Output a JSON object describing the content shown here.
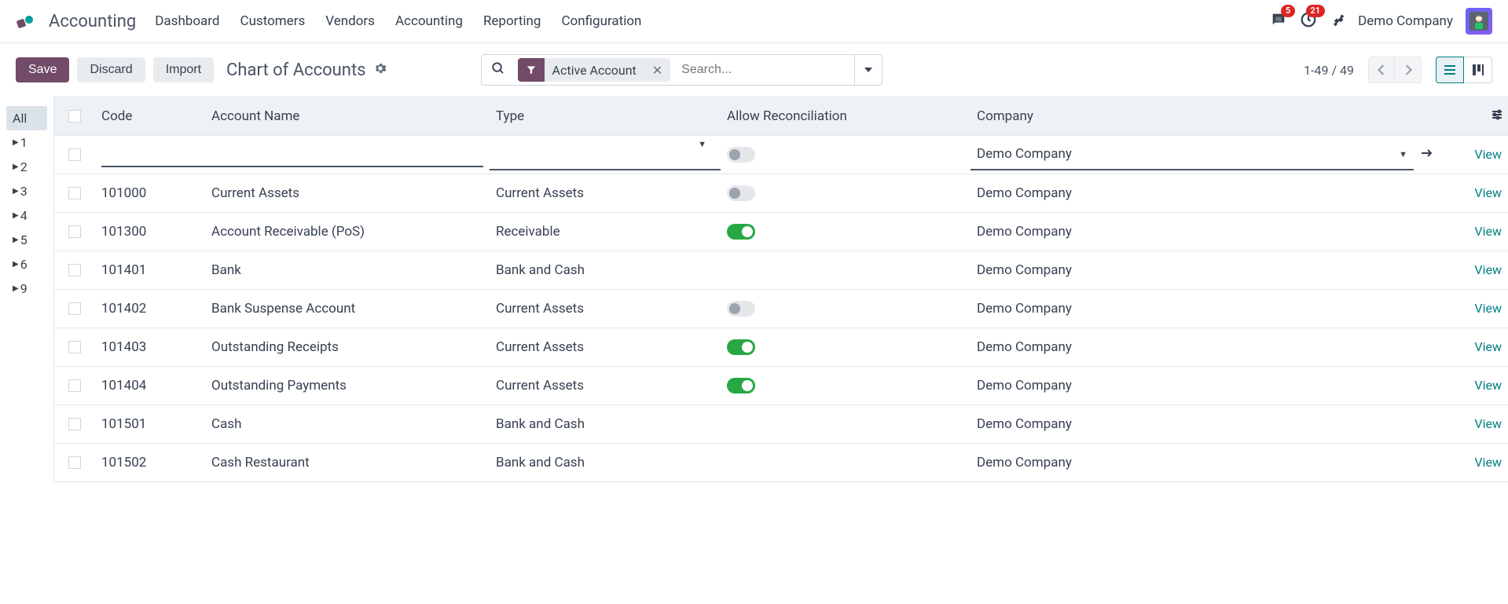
{
  "app_name": "Accounting",
  "nav": [
    "Dashboard",
    "Customers",
    "Vendors",
    "Accounting",
    "Reporting",
    "Configuration"
  ],
  "msg_badge": "5",
  "activity_badge": "21",
  "company": "Demo Company",
  "buttons": {
    "save": "Save",
    "discard": "Discard",
    "import": "Import"
  },
  "page_title": "Chart of Accounts",
  "filter_chip": "Active Account",
  "search_placeholder": "Search...",
  "pager": "1-49 / 49",
  "sidebar": {
    "all": "All",
    "items": [
      "1",
      "2",
      "3",
      "4",
      "5",
      "6",
      "9"
    ]
  },
  "columns": {
    "code": "Code",
    "name": "Account Name",
    "type": "Type",
    "recon": "Allow Reconciliation",
    "company": "Company"
  },
  "new_row_company": "Demo Company",
  "view_label": "View",
  "rows": [
    {
      "code": "101000",
      "name": "Current Assets",
      "type": "Current Assets",
      "recon": "off",
      "company": "Demo Company"
    },
    {
      "code": "101300",
      "name": "Account Receivable (PoS)",
      "type": "Receivable",
      "recon": "on",
      "company": "Demo Company"
    },
    {
      "code": "101401",
      "name": "Bank",
      "type": "Bank and Cash",
      "recon": "none",
      "company": "Demo Company"
    },
    {
      "code": "101402",
      "name": "Bank Suspense Account",
      "type": "Current Assets",
      "recon": "off",
      "company": "Demo Company"
    },
    {
      "code": "101403",
      "name": "Outstanding Receipts",
      "type": "Current Assets",
      "recon": "on",
      "company": "Demo Company"
    },
    {
      "code": "101404",
      "name": "Outstanding Payments",
      "type": "Current Assets",
      "recon": "on",
      "company": "Demo Company"
    },
    {
      "code": "101501",
      "name": "Cash",
      "type": "Bank and Cash",
      "recon": "none",
      "company": "Demo Company"
    },
    {
      "code": "101502",
      "name": "Cash Restaurant",
      "type": "Bank and Cash",
      "recon": "none",
      "company": "Demo Company"
    }
  ]
}
